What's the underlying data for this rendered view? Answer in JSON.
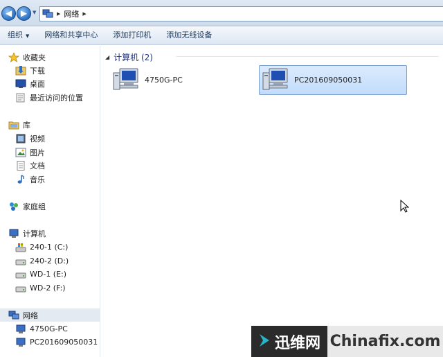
{
  "address_bar": {
    "crumbs": [
      "网络"
    ]
  },
  "toolbar": {
    "organize": "组织",
    "network_center": "网络和共享中心",
    "add_printer": "添加打印机",
    "add_wireless": "添加无线设备"
  },
  "sidebar": {
    "favorites": "收藏夹",
    "downloads": "下载",
    "desktop": "桌面",
    "recent": "最近访问的位置",
    "libraries": "库",
    "videos": "视频",
    "pictures": "图片",
    "documents": "文档",
    "music": "音乐",
    "homegroup": "家庭组",
    "computer": "计算机",
    "drives": [
      "240-1 (C:)",
      "240-2 (D:)",
      "WD-1 (E:)",
      "WD-2 (F:)"
    ],
    "network": "网络",
    "network_pcs": [
      "4750G-PC",
      "PC201609050031"
    ]
  },
  "content": {
    "group_title": "计算机 (2)",
    "computers": [
      "4750G-PC",
      "PC201609050031"
    ]
  },
  "watermark": {
    "brand": "迅维网",
    "domain": "Chinafix.com"
  },
  "colors": {
    "accent": "#1e3287",
    "selection": "#c1dcfc",
    "toolbar_text": "#1e395b"
  }
}
